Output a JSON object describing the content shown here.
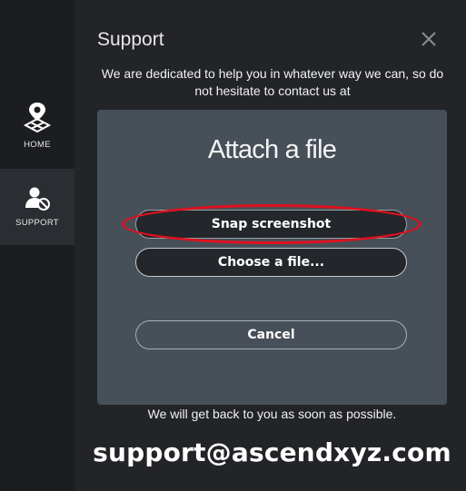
{
  "sidebar": {
    "items": [
      {
        "label": "HOME",
        "icon": "home-map-icon"
      },
      {
        "label": "SUPPORT",
        "icon": "support-user-icon"
      }
    ]
  },
  "support": {
    "title": "Support",
    "intro": "We are dedicated to help you in whatever way we can, so do not hesitate to contact us at",
    "followup": "We will get back to you as soon as possible.",
    "email": "support@ascendxyz.com"
  },
  "attach_modal": {
    "title": "Attach a file",
    "snap_label": "Snap screenshot",
    "choose_label": "Choose a file...",
    "cancel_label": "Cancel"
  },
  "colors": {
    "highlight": "#e0101f",
    "modal_bg": "#474f58",
    "panel_bg": "#222427"
  }
}
